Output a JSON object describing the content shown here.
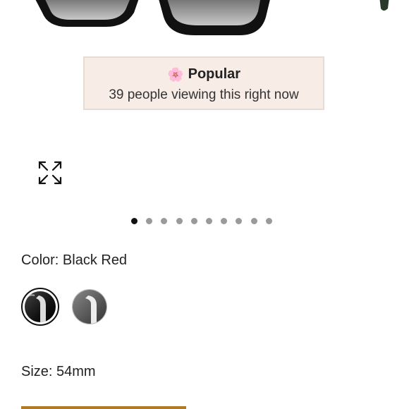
{
  "gallery": {
    "badge": {
      "icon": "flower-icon",
      "title": "Popular",
      "subtitle": "39 people viewing this right now"
    },
    "expand_icon": "expand-arrows-icon",
    "dots": {
      "count": 10,
      "active_index": 0
    }
  },
  "product": {
    "color_label": "Color: Black Red",
    "swatches": [
      {
        "name": "Black Red",
        "selected": true,
        "color": "#1a1a1a"
      },
      {
        "name": "Grey",
        "selected": false,
        "color": "#6b6b6b"
      }
    ],
    "size_label": "Size: 54mm"
  },
  "colors": {
    "accent": "#b07a27",
    "badge_bg": "#f7ece6"
  }
}
